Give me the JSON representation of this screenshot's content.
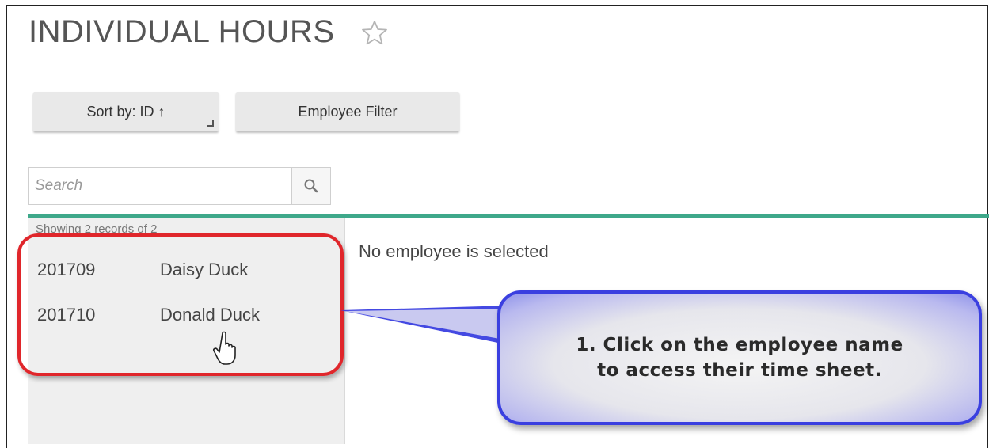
{
  "page": {
    "title": "INDIVIDUAL HOURS"
  },
  "toolbar": {
    "sort_label": "Sort by: ID ↑",
    "filter_label": "Employee Filter"
  },
  "search": {
    "placeholder": "Search",
    "value": ""
  },
  "list": {
    "records_text": "Showing 2 records of 2",
    "rows": [
      {
        "id": "201709",
        "name": "Daisy Duck"
      },
      {
        "id": "201710",
        "name": "Donald Duck"
      }
    ]
  },
  "detail": {
    "message": "No employee is selected"
  },
  "callout": {
    "line1": "1. Click on the employee name",
    "line2": "to access their time sheet."
  },
  "colors": {
    "accent": "#3ea88a",
    "highlight_red": "#e0262b",
    "callout_blue": "#3a3fe0"
  },
  "icons": [
    "star-icon",
    "search-icon",
    "hand-cursor-icon"
  ]
}
